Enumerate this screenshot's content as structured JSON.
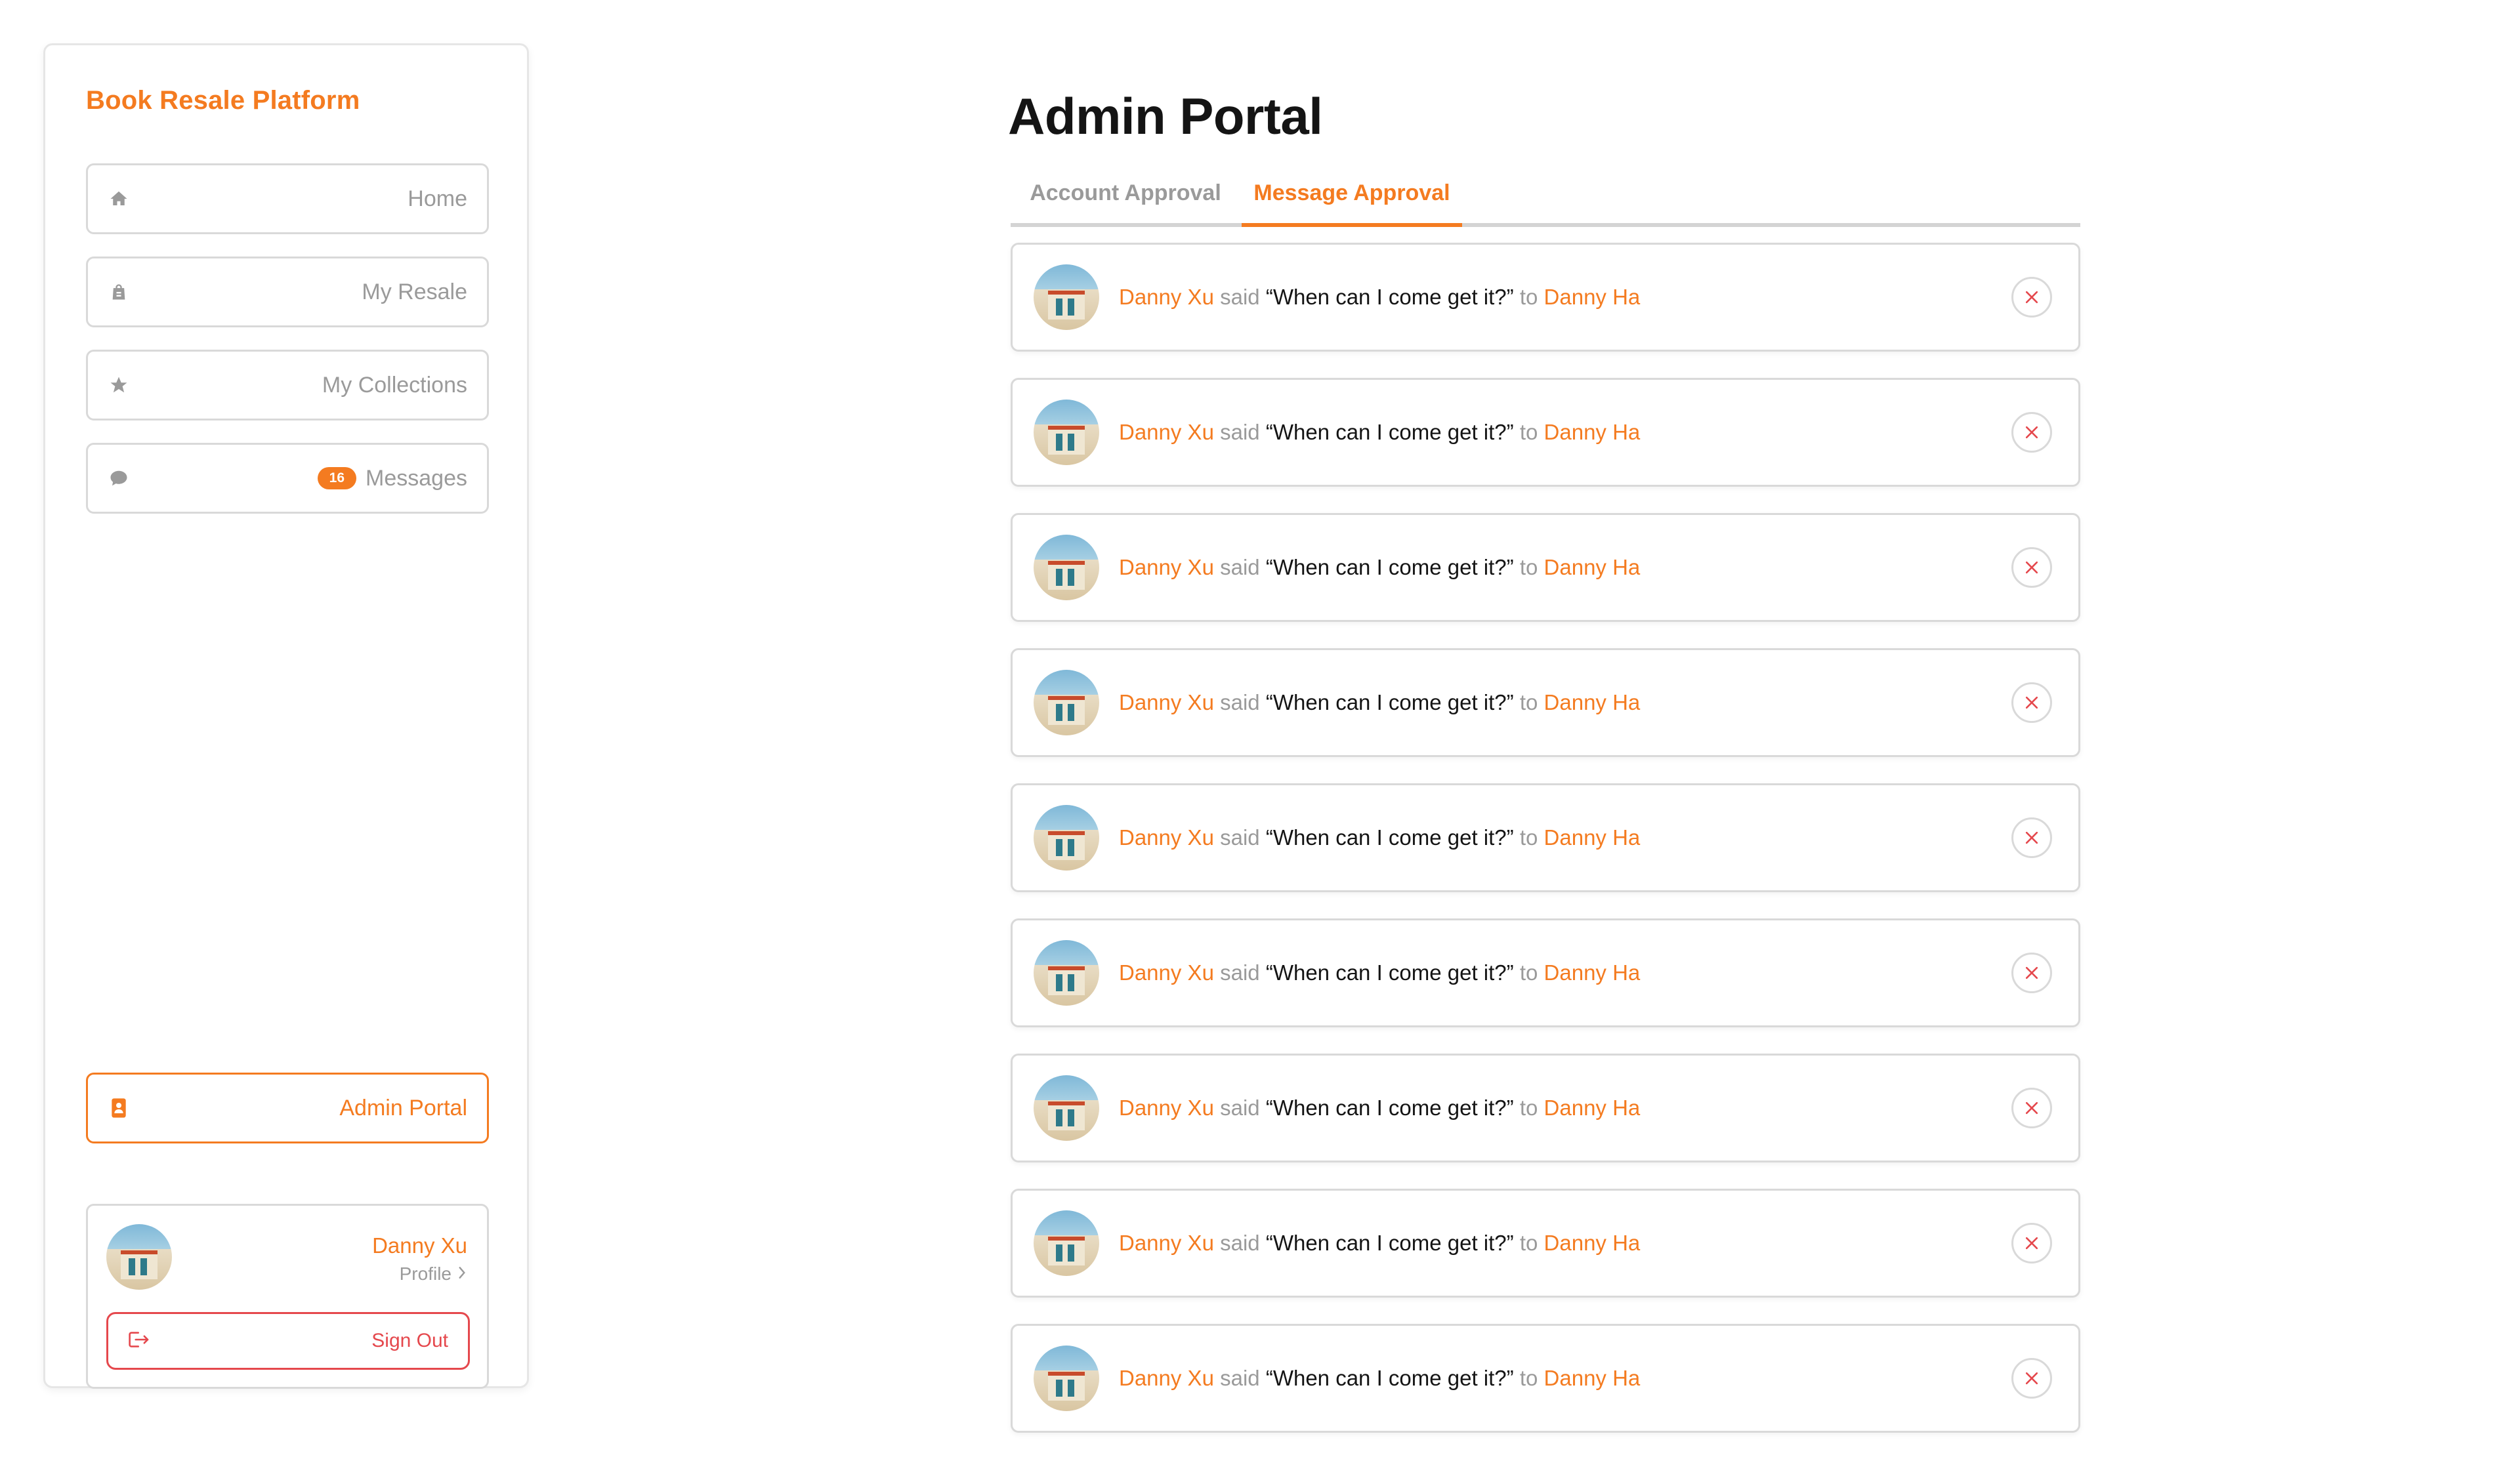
{
  "app": {
    "title": "Book Resale Platform"
  },
  "colors": {
    "accent": "#f47b20",
    "danger": "#e5484d",
    "muted": "#9a9a9a"
  },
  "sidebar": {
    "nav": [
      {
        "label": "Home",
        "icon": "home-icon"
      },
      {
        "label": "My Resale",
        "icon": "shopping-bag-icon"
      },
      {
        "label": "My Collections",
        "icon": "star-icon"
      },
      {
        "label": "Messages",
        "icon": "chat-bubble-icon",
        "badge": "16"
      }
    ],
    "admin": {
      "label": "Admin Portal",
      "icon": "id-badge-icon"
    },
    "profile": {
      "name": "Danny Xu",
      "link_label": "Profile",
      "link_icon": "chevron-right-icon"
    },
    "signout": {
      "label": "Sign Out",
      "icon": "sign-out-icon"
    }
  },
  "main": {
    "title": "Admin Portal",
    "tabs": [
      {
        "label": "Account Approval",
        "active": false
      },
      {
        "label": "Message Approval",
        "active": true
      }
    ],
    "messages": [
      {
        "sender": "Danny Xu",
        "said": "said",
        "quote": "“When can I come get it?”",
        "to": "to",
        "recipient": "Danny Ha"
      },
      {
        "sender": "Danny Xu",
        "said": "said",
        "quote": "“When can I come get it?”",
        "to": "to",
        "recipient": "Danny Ha"
      },
      {
        "sender": "Danny Xu",
        "said": "said",
        "quote": "“When can I come get it?”",
        "to": "to",
        "recipient": "Danny Ha"
      },
      {
        "sender": "Danny Xu",
        "said": "said",
        "quote": "“When can I come get it?”",
        "to": "to",
        "recipient": "Danny Ha"
      },
      {
        "sender": "Danny Xu",
        "said": "said",
        "quote": "“When can I come get it?”",
        "to": "to",
        "recipient": "Danny Ha"
      },
      {
        "sender": "Danny Xu",
        "said": "said",
        "quote": "“When can I come get it?”",
        "to": "to",
        "recipient": "Danny Ha"
      },
      {
        "sender": "Danny Xu",
        "said": "said",
        "quote": "“When can I come get it?”",
        "to": "to",
        "recipient": "Danny Ha"
      },
      {
        "sender": "Danny Xu",
        "said": "said",
        "quote": "“When can I come get it?”",
        "to": "to",
        "recipient": "Danny Ha"
      },
      {
        "sender": "Danny Xu",
        "said": "said",
        "quote": "“When can I come get it?”",
        "to": "to",
        "recipient": "Danny Ha"
      }
    ]
  }
}
